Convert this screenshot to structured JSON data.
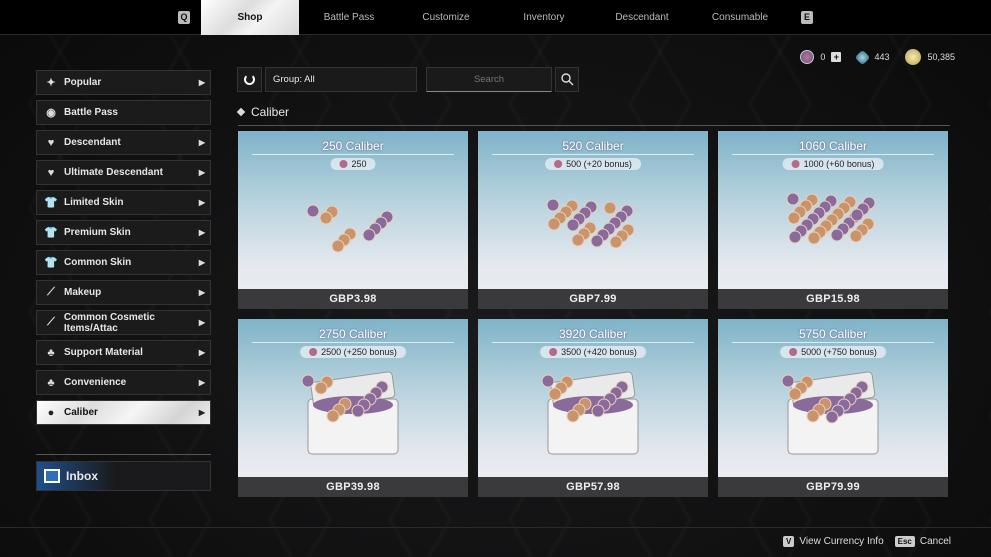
{
  "topbar": {
    "prev_key": "Q",
    "next_key": "E",
    "tabs": [
      "Shop",
      "Battle Pass",
      "Customize",
      "Inventory",
      "Descendant",
      "Consumable"
    ]
  },
  "currency": {
    "caliber": "0",
    "crystal": "443",
    "gold": "50,385"
  },
  "sidebar": {
    "items": [
      {
        "label": "Popular",
        "icon": "stars-icon",
        "arrow": true
      },
      {
        "label": "Battle Pass",
        "icon": "battle-pass-icon",
        "arrow": false
      },
      {
        "label": "Descendant",
        "icon": "descendant-icon",
        "arrow": true
      },
      {
        "label": "Ultimate Descendant",
        "icon": "ultimate-descendant-icon",
        "arrow": true
      },
      {
        "label": "Limited Skin",
        "icon": "shirt-icon",
        "arrow": true
      },
      {
        "label": "Premium Skin",
        "icon": "shirt-icon",
        "arrow": true
      },
      {
        "label": "Common Skin",
        "icon": "shirt-icon",
        "arrow": true
      },
      {
        "label": "Makeup",
        "icon": "wand-icon",
        "arrow": true
      },
      {
        "label": "Common Cosmetic Items/Attac",
        "icon": "wand-icon",
        "arrow": true
      },
      {
        "label": "Support Material",
        "icon": "support-icon",
        "arrow": true
      },
      {
        "label": "Convenience",
        "icon": "support-icon",
        "arrow": true
      },
      {
        "label": "Caliber",
        "icon": "caliber-icon",
        "arrow": true
      }
    ],
    "active": "Caliber",
    "inbox": "Inbox"
  },
  "toolbar": {
    "group": "Group: All",
    "search_placeholder": "Search"
  },
  "section": {
    "title": "Caliber"
  },
  "products": [
    {
      "title": "250 Caliber",
      "amount": "250",
      "price": "GBP3.98",
      "kind": "coins"
    },
    {
      "title": "520 Caliber",
      "amount": "500 (+20 bonus)",
      "price": "GBP7.99",
      "kind": "coins"
    },
    {
      "title": "1060 Caliber",
      "amount": "1000 (+60 bonus)",
      "price": "GBP15.98",
      "kind": "coins"
    },
    {
      "title": "2750 Caliber",
      "amount": "2500 (+250 bonus)",
      "price": "GBP39.98",
      "kind": "chest"
    },
    {
      "title": "3920 Caliber",
      "amount": "3500 (+420 bonus)",
      "price": "GBP57.98",
      "kind": "chest"
    },
    {
      "title": "5750 Caliber",
      "amount": "5000 (+750 bonus)",
      "price": "GBP79.99",
      "kind": "chest"
    }
  ],
  "footer": {
    "view_key": "V",
    "view_label": "View Currency Info",
    "cancel_key": "Esc",
    "cancel_label": "Cancel"
  }
}
